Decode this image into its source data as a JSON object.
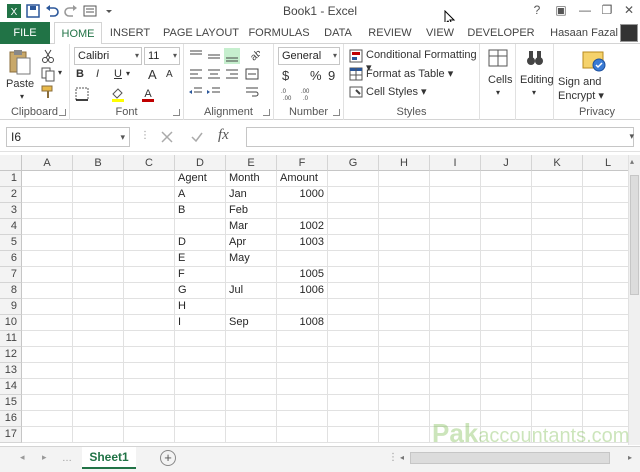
{
  "window": {
    "title": "Book1 - Excel",
    "help": "?",
    "minimize": "—",
    "restore": "❐",
    "close": "✕"
  },
  "tabs": [
    "FILE",
    "HOME",
    "INSERT",
    "PAGE LAYOUT",
    "FORMULAS",
    "DATA",
    "REVIEW",
    "VIEW",
    "DEVELOPER"
  ],
  "user": "Hasaan Fazal",
  "ribbon": {
    "clipboard": {
      "paste": "Paste",
      "label": "Clipboard"
    },
    "font": {
      "name": "Calibri",
      "size": "11",
      "bold": "B",
      "italic": "I",
      "underline": "U",
      "grow": "A",
      "shrink": "A",
      "label": "Font"
    },
    "alignment": {
      "label": "Alignment"
    },
    "number": {
      "format": "General",
      "currency": "$",
      "percent": "%",
      "comma": "9",
      "label": "Number"
    },
    "styles": {
      "conditional": "Conditional Formatting",
      "table": "Format as Table",
      "cellstyles": "Cell Styles",
      "label": "Styles"
    },
    "cells": {
      "label": "Cells"
    },
    "editing": {
      "label": "Editing"
    },
    "privacy": {
      "sign": "Sign and",
      "encrypt": "Encrypt",
      "label": "Privacy"
    }
  },
  "formula_bar": {
    "name_box": "I6",
    "fx": "fx",
    "value": ""
  },
  "columns": [
    "A",
    "B",
    "C",
    "D",
    "E",
    "F",
    "G",
    "H",
    "I",
    "J",
    "K",
    "L"
  ],
  "rows": [
    "1",
    "2",
    "3",
    "4",
    "5",
    "6",
    "7",
    "8",
    "9",
    "10",
    "11",
    "12",
    "13",
    "14",
    "15",
    "16",
    "17"
  ],
  "cells": [
    {
      "col": "D",
      "row": 1,
      "text": "Agent"
    },
    {
      "col": "E",
      "row": 1,
      "text": "Month"
    },
    {
      "col": "F",
      "row": 1,
      "text": "Amount"
    },
    {
      "col": "D",
      "row": 2,
      "text": "A"
    },
    {
      "col": "E",
      "row": 2,
      "text": "Jan"
    },
    {
      "col": "F",
      "row": 2,
      "text": "1000",
      "num": true
    },
    {
      "col": "D",
      "row": 3,
      "text": "B"
    },
    {
      "col": "E",
      "row": 3,
      "text": "Feb"
    },
    {
      "col": "E",
      "row": 4,
      "text": "Mar"
    },
    {
      "col": "F",
      "row": 4,
      "text": "1002",
      "num": true
    },
    {
      "col": "D",
      "row": 5,
      "text": "D"
    },
    {
      "col": "E",
      "row": 5,
      "text": "Apr"
    },
    {
      "col": "F",
      "row": 5,
      "text": "1003",
      "num": true
    },
    {
      "col": "D",
      "row": 6,
      "text": "E"
    },
    {
      "col": "E",
      "row": 6,
      "text": "May"
    },
    {
      "col": "D",
      "row": 7,
      "text": "F"
    },
    {
      "col": "F",
      "row": 7,
      "text": "1005",
      "num": true
    },
    {
      "col": "D",
      "row": 8,
      "text": "G"
    },
    {
      "col": "E",
      "row": 8,
      "text": "Jul"
    },
    {
      "col": "F",
      "row": 8,
      "text": "1006",
      "num": true
    },
    {
      "col": "D",
      "row": 9,
      "text": "H"
    },
    {
      "col": "D",
      "row": 10,
      "text": "I"
    },
    {
      "col": "E",
      "row": 10,
      "text": "Sep"
    },
    {
      "col": "F",
      "row": 10,
      "text": "1008",
      "num": true
    }
  ],
  "sheet": {
    "name": "Sheet1",
    "add": "+"
  },
  "watermark": {
    "main": "Pak",
    "rest": "accountants.com"
  },
  "colors": {
    "accent": "#217346"
  }
}
